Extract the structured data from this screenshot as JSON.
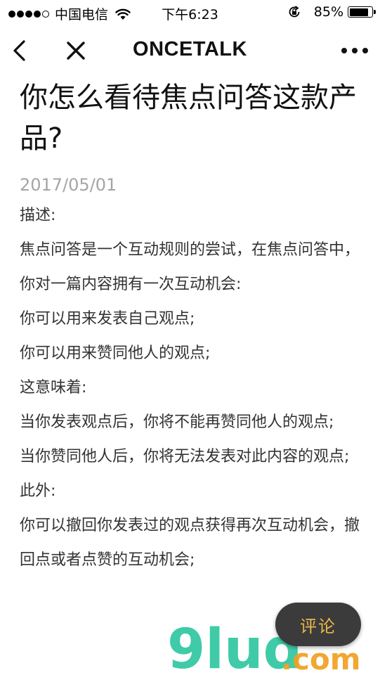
{
  "status_bar": {
    "carrier": "中国电信",
    "time": "下午6:23",
    "battery_percent": "85%",
    "battery_level": 0.85,
    "signal_bars_filled": 4,
    "signal_bars_total": 5,
    "icons": [
      "wifi-icon",
      "orientation-lock-icon",
      "battery-icon"
    ]
  },
  "nav": {
    "title": "ONCETALK",
    "icons": [
      "back-chevron-icon",
      "close-icon",
      "more-dots-icon"
    ]
  },
  "article": {
    "title": "你怎么看待焦点问答这款产品?",
    "date": "2017/05/01",
    "paragraphs": [
      "描述:",
      "焦点问答是一个互动规则的尝试，在焦点问答中，你对一篇内容拥有一次互动机会:",
      "你可以用来发表自己观点;",
      "你可以用来赞同他人的观点;",
      "这意味着:",
      "当你发表观点后，你将不能再赞同他人的观点;",
      "当你赞同他人后，你将无法发表对此内容的观点;",
      "此外:",
      "你可以撤回你发表过的观点获得再次互动机会，撤回点或者点赞的互动机会;"
    ]
  },
  "comment_button": {
    "label": "评论"
  },
  "watermark": {
    "text_left": "9lud",
    "text_right": ".com"
  },
  "colors": {
    "date": "#a5a5a5",
    "comment_bg": "#3b3b3b",
    "comment_text": "#e8b84a",
    "watermark_green": "#2fc7a0",
    "watermark_orange": "#f0a020"
  }
}
